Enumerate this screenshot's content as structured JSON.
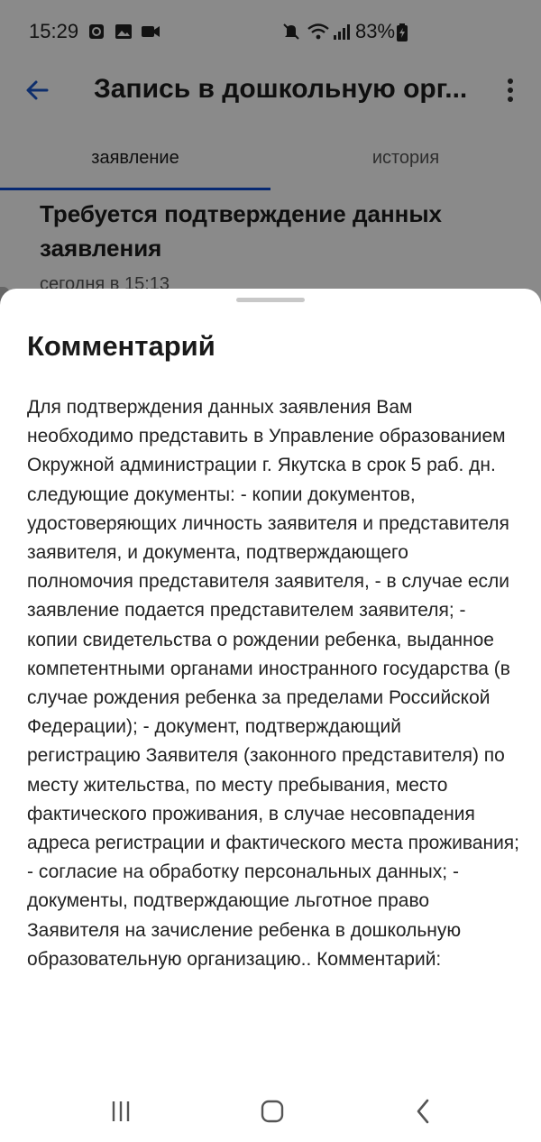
{
  "status_bar": {
    "time": "15:29",
    "battery": "83%",
    "left_icons": [
      "sync-icon",
      "image-icon",
      "video-icon"
    ],
    "right_icons": [
      "mute-icon",
      "wifi-icon",
      "signal-icon",
      "battery-icon"
    ]
  },
  "app_bar": {
    "title": "Запись в дошкольную орг..."
  },
  "tabs": [
    {
      "label": "заявление",
      "selected": true
    },
    {
      "label": "история",
      "selected": false
    }
  ],
  "card": {
    "title": "Требуется подтверждение данных заявления",
    "date": "сегодня в 15:13"
  },
  "sheet": {
    "title": "Комментарий",
    "body": "Для подтверждения данных заявления Вам необходимо представить в Управление образованием Окружной администрации г. Якутска в срок 5 раб. дн. следующие документы: - копии документов, удостоверяющих личность заявителя и представителя заявителя, и документа, подтверждающего полномочия представителя заявителя, - в случае если заявление подается представителем заявителя; - копии свидетельства о рождении ребенка, выданное компетентными органами иностранного государства (в случае рождения ребенка за пределами Российской Федерации); - документ, подтверждающий регистрацию Заявителя (законного представителя) по месту жительства, по месту пребывания, место фактического проживания, в случае несовпадения адреса регистрации и фактического места проживания; - согласие на обработку персональных данных; - документы, подтверждающие льготное право Заявителя на зачисление ребенка в дошкольную образовательную организацию.. Комментарий:"
  },
  "colors": {
    "accent": "#0d4cd3",
    "scrim": "rgba(0,0,0,0.46)"
  },
  "nav_bar": {
    "buttons": [
      "recents-icon",
      "home-icon",
      "back-icon"
    ]
  }
}
